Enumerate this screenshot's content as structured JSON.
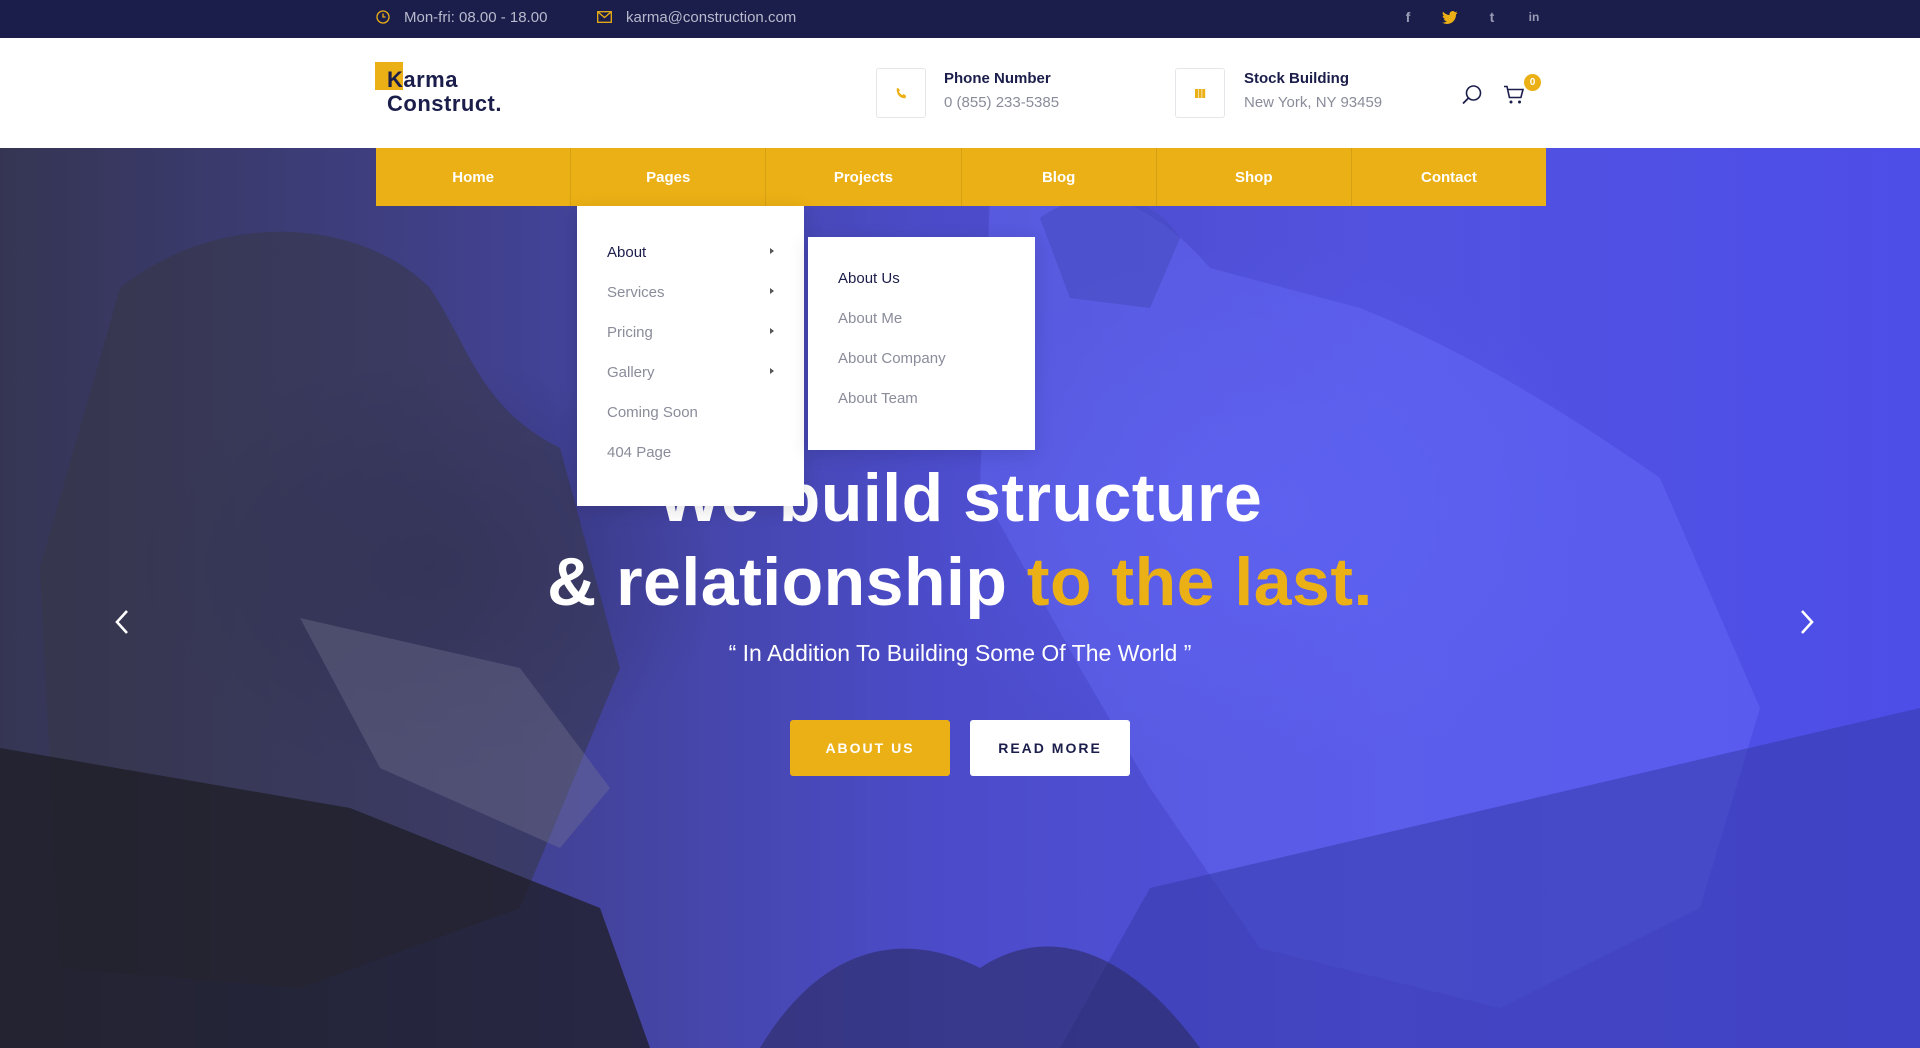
{
  "topbar": {
    "hours": "Mon-fri: 08.00 - 18.00",
    "email": "karma@construction.com",
    "socials": [
      {
        "icon": "facebook-icon",
        "glyph": "f"
      },
      {
        "icon": "twitter-icon",
        "glyph": "t"
      },
      {
        "icon": "tumblr-icon",
        "glyph": "t"
      },
      {
        "icon": "linkedin-icon",
        "glyph": "in"
      }
    ]
  },
  "header": {
    "logo_line1": "Karma",
    "logo_line2": "Construct.",
    "phone": {
      "title": "Phone Number",
      "value": "0 (855) 233-5385",
      "icon": "phone-icon"
    },
    "location": {
      "title": "Stock Building",
      "value": "New York, NY 93459",
      "icon": "building-icon"
    },
    "cart_count": "0"
  },
  "nav": {
    "items": [
      "Home",
      "Pages",
      "Projects",
      "Blog",
      "Shop",
      "Contact"
    ]
  },
  "dropdown": {
    "main": [
      "About",
      "Services",
      "Pricing",
      "Gallery",
      "Coming Soon",
      "404 Page"
    ],
    "sub": [
      "About Us",
      "About Me",
      "About Company",
      "About Team"
    ]
  },
  "hero": {
    "title_line1": "We build structure",
    "title_line2_white": "& relationship ",
    "title_line2_accent": "to the last.",
    "quote": "“ In Addition To Building Some Of The World ”",
    "btn_primary": "ABOUT US",
    "btn_secondary": "READ MORE"
  },
  "colors": {
    "accent": "#ebb015",
    "navy": "#1b1d4b",
    "overlay_blue": "#4b4bd8"
  }
}
